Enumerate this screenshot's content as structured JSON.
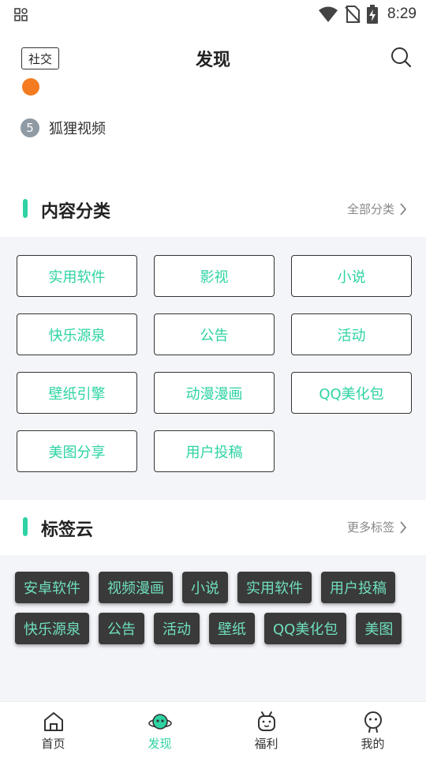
{
  "status_bar": {
    "time": "8:29"
  },
  "header": {
    "social_label": "社交",
    "title": "发现"
  },
  "ranking": {
    "item": {
      "rank": "5",
      "label": "狐狸视频"
    }
  },
  "category_section": {
    "title": "内容分类",
    "more_label": "全部分类",
    "items": [
      "实用软件",
      "影视",
      "小说",
      "快乐源泉",
      "公告",
      "活动",
      "壁纸引擎",
      "动漫漫画",
      "QQ美化包",
      "美图分享",
      "用户投稿"
    ]
  },
  "tag_section": {
    "title": "标签云",
    "more_label": "更多标签",
    "tags": [
      "安卓软件",
      "视频漫画",
      "小说",
      "实用软件",
      "用户投稿",
      "快乐源泉",
      "公告",
      "活动",
      "壁纸",
      "QQ美化包",
      "美图"
    ]
  },
  "bottom_nav": {
    "items": [
      {
        "label": "首页",
        "icon": "home-icon"
      },
      {
        "label": "发现",
        "icon": "discover-planet-icon"
      },
      {
        "label": "福利",
        "icon": "gift-icon"
      },
      {
        "label": "我的",
        "icon": "profile-icon"
      }
    ],
    "active": "发现"
  },
  "colors": {
    "accent": "#2ed3a3",
    "tag_bg": "#3a3a3a",
    "tag_text": "#6fe0be",
    "rank_badge": "#8f9aa3",
    "page_bg": "#f4f5f9"
  }
}
